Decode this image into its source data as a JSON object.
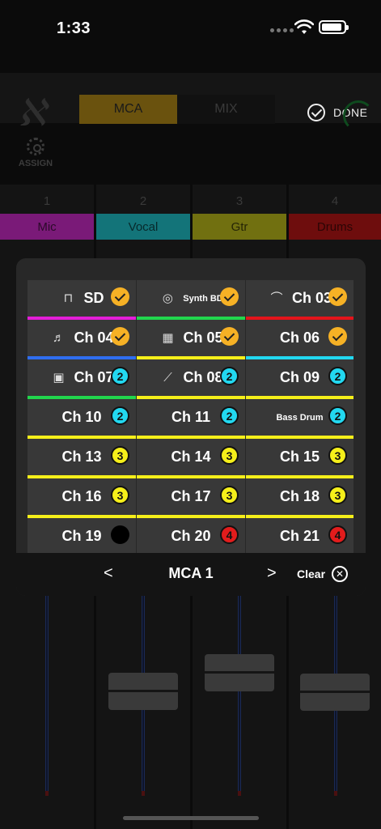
{
  "status": {
    "time": "1:33"
  },
  "header": {
    "tabs": [
      {
        "label": "MCA",
        "active": true
      },
      {
        "label": "MIX",
        "active": false
      }
    ],
    "done_label": "DONE",
    "assign_label": "ASSIGN"
  },
  "strips": [
    {
      "num": "1",
      "label": "Mic",
      "color": "#7a1a78",
      "text_color": "#2a0a29"
    },
    {
      "num": "2",
      "label": "Vocal",
      "color": "#137479",
      "text_color": "#07292b"
    },
    {
      "num": "3",
      "label": "Gtr",
      "color": "#717010",
      "text_color": "#262505"
    },
    {
      "num": "4",
      "label": "Drums",
      "color": "#6e0d0d",
      "text_color": "#2b0505"
    }
  ],
  "modal": {
    "channels": [
      {
        "name": "SD",
        "icon": "drum-kit-icon",
        "badge": "check",
        "underline": "#e31ed8"
      },
      {
        "name": "Synth BD",
        "icon": "bass-drum-icon",
        "badge": "check",
        "underline": "#21d64d",
        "small": true
      },
      {
        "name": "Ch 03",
        "icon": "cymbal-icon",
        "badge": "check",
        "underline": "#e3141b"
      },
      {
        "name": "Ch 04",
        "icon": "guitar-icon",
        "badge": "check",
        "underline": "#2f6ef0"
      },
      {
        "name": "Ch 05",
        "icon": "keyboard-icon",
        "badge": "check",
        "underline": "#f5ef1a"
      },
      {
        "name": "Ch 06",
        "icon": "",
        "badge": "check",
        "underline": "#22d8f0"
      },
      {
        "name": "Ch 07",
        "icon": "amplifier-icon",
        "badge": "2",
        "underline": "#21d64d"
      },
      {
        "name": "Ch 08",
        "icon": "electric-guitar-icon",
        "badge": "2",
        "underline": "#f5ef1a"
      },
      {
        "name": "Ch 09",
        "icon": "",
        "badge": "2",
        "underline": "#f5ef1a"
      },
      {
        "name": "Ch 10",
        "icon": "",
        "badge": "2",
        "underline": "#f5ef1a"
      },
      {
        "name": "Ch 11",
        "icon": "",
        "badge": "2",
        "underline": "#f5ef1a"
      },
      {
        "name": "Bass Drum",
        "icon": "",
        "badge": "2",
        "underline": "#f5ef1a",
        "small": true
      },
      {
        "name": "Ch 13",
        "icon": "",
        "badge": "3",
        "underline": "#f5ef1a"
      },
      {
        "name": "Ch 14",
        "icon": "",
        "badge": "3",
        "underline": "#f5ef1a"
      },
      {
        "name": "Ch 15",
        "icon": "",
        "badge": "3",
        "underline": "#f5ef1a"
      },
      {
        "name": "Ch 16",
        "icon": "",
        "badge": "3",
        "underline": "#f5ef1a"
      },
      {
        "name": "Ch 17",
        "icon": "",
        "badge": "3",
        "underline": "#f5ef1a"
      },
      {
        "name": "Ch 18",
        "icon": "",
        "badge": "3",
        "underline": "#f5ef1a"
      },
      {
        "name": "Ch 19",
        "icon": "",
        "badge": "none",
        "underline": ""
      },
      {
        "name": "Ch 20",
        "icon": "",
        "badge": "4",
        "underline": ""
      },
      {
        "name": "Ch 21",
        "icon": "",
        "badge": "4",
        "underline": ""
      }
    ],
    "footer": {
      "prev": "<",
      "title": "MCA 1",
      "next": ">",
      "clear_label": "Clear"
    }
  }
}
